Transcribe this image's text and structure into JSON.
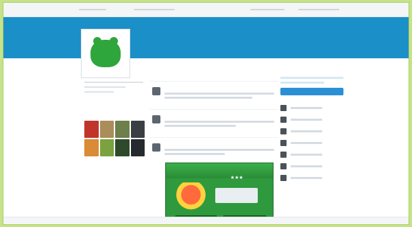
{
  "nav": {
    "items": [
      "",
      "",
      "",
      ""
    ]
  },
  "subtabs": [
    "",
    "",
    "",
    ""
  ],
  "subnav_right": "",
  "profile": {
    "name": "",
    "handle": ""
  },
  "photos_label": "",
  "photos": [
    {
      "color": "#c0352b"
    },
    {
      "color": "#a98d5a"
    },
    {
      "color": "#6d7f4a"
    },
    {
      "color": "#3a3f44"
    },
    {
      "color": "#d98b35"
    },
    {
      "color": "#7aa23f"
    },
    {
      "color": "#2f4a2a"
    },
    {
      "color": "#252a2e"
    }
  ],
  "feed": {
    "header": "",
    "tweets": [
      {
        "name": "",
        "time": ""
      },
      {
        "name": "",
        "time": ""
      },
      {
        "name": "",
        "time": ""
      }
    ]
  },
  "ad": {
    "title": "",
    "stars": "★★★",
    "cta_left": "",
    "cta_right": ""
  },
  "aside": {
    "follow_label": "",
    "who_label": "",
    "people": [
      {},
      {},
      {},
      {},
      {},
      {},
      {}
    ]
  },
  "colors": {
    "banner": "#1b8fc8",
    "page_bg": "#c6e28a",
    "accent": "#2b8fd6",
    "ad_green": "#2f9a3d"
  }
}
